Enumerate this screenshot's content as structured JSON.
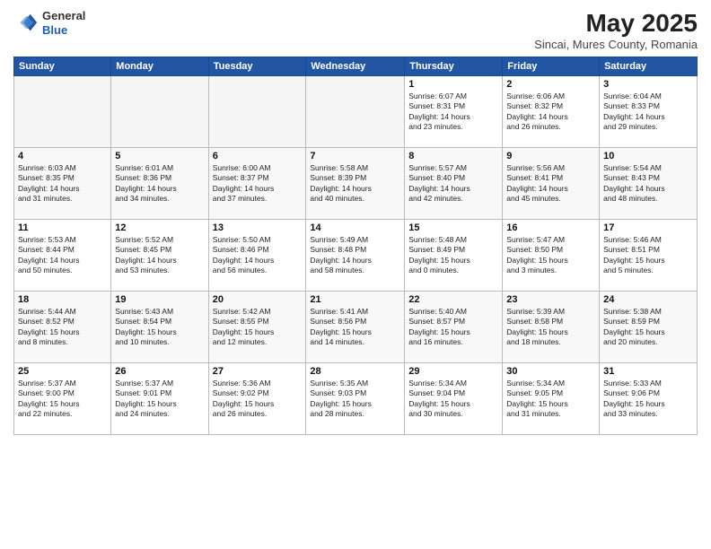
{
  "header": {
    "logo_line1": "General",
    "logo_line2": "Blue",
    "month": "May 2025",
    "location": "Sincai, Mures County, Romania"
  },
  "weekdays": [
    "Sunday",
    "Monday",
    "Tuesday",
    "Wednesday",
    "Thursday",
    "Friday",
    "Saturday"
  ],
  "weeks": [
    [
      {
        "day": "",
        "info": ""
      },
      {
        "day": "",
        "info": ""
      },
      {
        "day": "",
        "info": ""
      },
      {
        "day": "",
        "info": ""
      },
      {
        "day": "1",
        "info": "Sunrise: 6:07 AM\nSunset: 8:31 PM\nDaylight: 14 hours\nand 23 minutes."
      },
      {
        "day": "2",
        "info": "Sunrise: 6:06 AM\nSunset: 8:32 PM\nDaylight: 14 hours\nand 26 minutes."
      },
      {
        "day": "3",
        "info": "Sunrise: 6:04 AM\nSunset: 8:33 PM\nDaylight: 14 hours\nand 29 minutes."
      }
    ],
    [
      {
        "day": "4",
        "info": "Sunrise: 6:03 AM\nSunset: 8:35 PM\nDaylight: 14 hours\nand 31 minutes."
      },
      {
        "day": "5",
        "info": "Sunrise: 6:01 AM\nSunset: 8:36 PM\nDaylight: 14 hours\nand 34 minutes."
      },
      {
        "day": "6",
        "info": "Sunrise: 6:00 AM\nSunset: 8:37 PM\nDaylight: 14 hours\nand 37 minutes."
      },
      {
        "day": "7",
        "info": "Sunrise: 5:58 AM\nSunset: 8:39 PM\nDaylight: 14 hours\nand 40 minutes."
      },
      {
        "day": "8",
        "info": "Sunrise: 5:57 AM\nSunset: 8:40 PM\nDaylight: 14 hours\nand 42 minutes."
      },
      {
        "day": "9",
        "info": "Sunrise: 5:56 AM\nSunset: 8:41 PM\nDaylight: 14 hours\nand 45 minutes."
      },
      {
        "day": "10",
        "info": "Sunrise: 5:54 AM\nSunset: 8:43 PM\nDaylight: 14 hours\nand 48 minutes."
      }
    ],
    [
      {
        "day": "11",
        "info": "Sunrise: 5:53 AM\nSunset: 8:44 PM\nDaylight: 14 hours\nand 50 minutes."
      },
      {
        "day": "12",
        "info": "Sunrise: 5:52 AM\nSunset: 8:45 PM\nDaylight: 14 hours\nand 53 minutes."
      },
      {
        "day": "13",
        "info": "Sunrise: 5:50 AM\nSunset: 8:46 PM\nDaylight: 14 hours\nand 56 minutes."
      },
      {
        "day": "14",
        "info": "Sunrise: 5:49 AM\nSunset: 8:48 PM\nDaylight: 14 hours\nand 58 minutes."
      },
      {
        "day": "15",
        "info": "Sunrise: 5:48 AM\nSunset: 8:49 PM\nDaylight: 15 hours\nand 0 minutes."
      },
      {
        "day": "16",
        "info": "Sunrise: 5:47 AM\nSunset: 8:50 PM\nDaylight: 15 hours\nand 3 minutes."
      },
      {
        "day": "17",
        "info": "Sunrise: 5:46 AM\nSunset: 8:51 PM\nDaylight: 15 hours\nand 5 minutes."
      }
    ],
    [
      {
        "day": "18",
        "info": "Sunrise: 5:44 AM\nSunset: 8:52 PM\nDaylight: 15 hours\nand 8 minutes."
      },
      {
        "day": "19",
        "info": "Sunrise: 5:43 AM\nSunset: 8:54 PM\nDaylight: 15 hours\nand 10 minutes."
      },
      {
        "day": "20",
        "info": "Sunrise: 5:42 AM\nSunset: 8:55 PM\nDaylight: 15 hours\nand 12 minutes."
      },
      {
        "day": "21",
        "info": "Sunrise: 5:41 AM\nSunset: 8:56 PM\nDaylight: 15 hours\nand 14 minutes."
      },
      {
        "day": "22",
        "info": "Sunrise: 5:40 AM\nSunset: 8:57 PM\nDaylight: 15 hours\nand 16 minutes."
      },
      {
        "day": "23",
        "info": "Sunrise: 5:39 AM\nSunset: 8:58 PM\nDaylight: 15 hours\nand 18 minutes."
      },
      {
        "day": "24",
        "info": "Sunrise: 5:38 AM\nSunset: 8:59 PM\nDaylight: 15 hours\nand 20 minutes."
      }
    ],
    [
      {
        "day": "25",
        "info": "Sunrise: 5:37 AM\nSunset: 9:00 PM\nDaylight: 15 hours\nand 22 minutes."
      },
      {
        "day": "26",
        "info": "Sunrise: 5:37 AM\nSunset: 9:01 PM\nDaylight: 15 hours\nand 24 minutes."
      },
      {
        "day": "27",
        "info": "Sunrise: 5:36 AM\nSunset: 9:02 PM\nDaylight: 15 hours\nand 26 minutes."
      },
      {
        "day": "28",
        "info": "Sunrise: 5:35 AM\nSunset: 9:03 PM\nDaylight: 15 hours\nand 28 minutes."
      },
      {
        "day": "29",
        "info": "Sunrise: 5:34 AM\nSunset: 9:04 PM\nDaylight: 15 hours\nand 30 minutes."
      },
      {
        "day": "30",
        "info": "Sunrise: 5:34 AM\nSunset: 9:05 PM\nDaylight: 15 hours\nand 31 minutes."
      },
      {
        "day": "31",
        "info": "Sunrise: 5:33 AM\nSunset: 9:06 PM\nDaylight: 15 hours\nand 33 minutes."
      }
    ]
  ]
}
